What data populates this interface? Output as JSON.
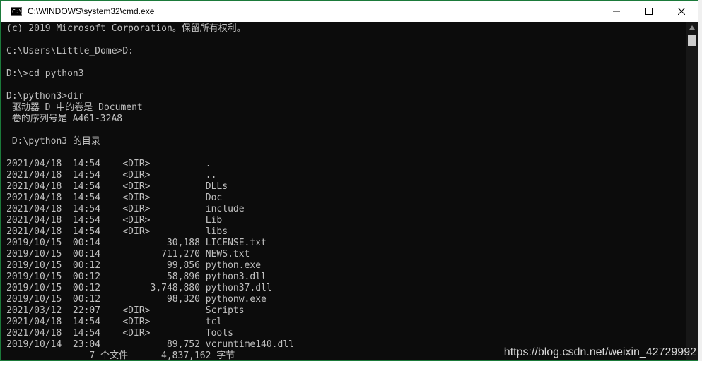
{
  "window": {
    "title": "C:\\WINDOWS\\system32\\cmd.exe",
    "icon": "cmd-app-icon",
    "controls": {
      "minimize": "minimize-icon",
      "maximize": "maximize-icon",
      "close": "close-icon"
    }
  },
  "terminal": {
    "lines": [
      "(c) 2019 Microsoft Corporation。保留所有权利。",
      "",
      "C:\\Users\\Little_Dome>D:",
      "",
      "D:\\>cd python3",
      "",
      "D:\\python3>dir",
      " 驱动器 D 中的卷是 Document",
      " 卷的序列号是 A461-32A8",
      "",
      " D:\\python3 的目录",
      "",
      "2021/04/18  14:54    <DIR>          .",
      "2021/04/18  14:54    <DIR>          ..",
      "2021/04/18  14:54    <DIR>          DLLs",
      "2021/04/18  14:54    <DIR>          Doc",
      "2021/04/18  14:54    <DIR>          include",
      "2021/04/18  14:54    <DIR>          Lib",
      "2021/04/18  14:54    <DIR>          libs",
      "2019/10/15  00:14            30,188 LICENSE.txt",
      "2019/10/15  00:14           711,270 NEWS.txt",
      "2019/10/15  00:12            99,856 python.exe",
      "2019/10/15  00:12            58,896 python3.dll",
      "2019/10/15  00:12         3,748,880 python37.dll",
      "2019/10/15  00:12            98,320 pythonw.exe",
      "2021/03/12  22:07    <DIR>          Scripts",
      "2021/04/18  14:54    <DIR>          tcl",
      "2021/04/18  14:54    <DIR>          Tools",
      "2019/10/14  23:04            89,752 vcruntime140.dll",
      "               7 个文件      4,837,162 字节"
    ]
  },
  "watermark": "https://blog.csdn.net/weixin_42729992",
  "colors": {
    "terminal_bg": "#0c0c0c",
    "terminal_fg": "#c0c0c0",
    "titlebar_bg": "#ffffff",
    "border": "#1b7a3a"
  }
}
